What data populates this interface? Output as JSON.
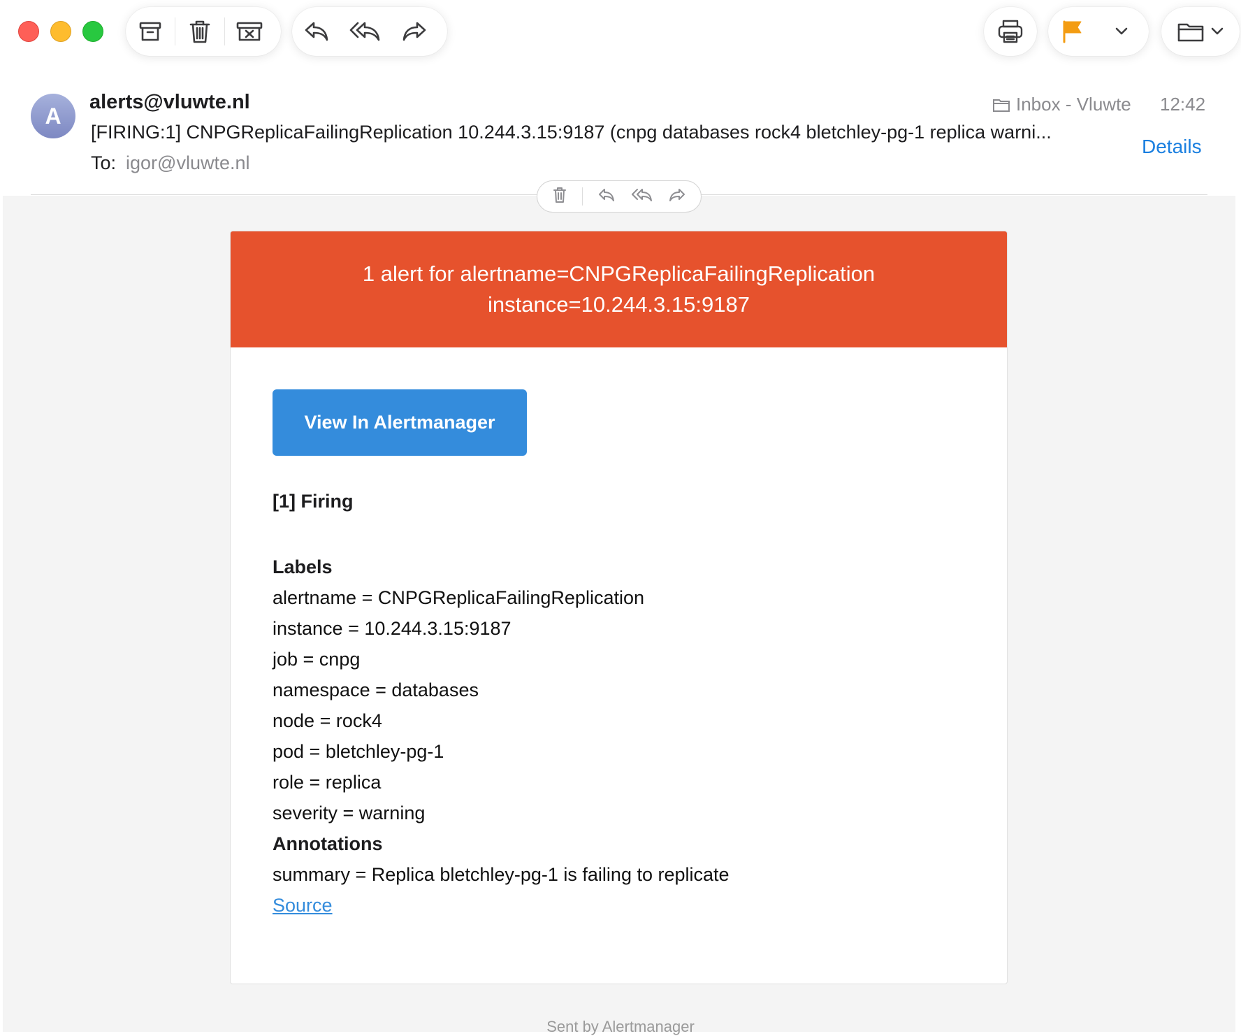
{
  "toolbar": {
    "archive_icon": "archive-box-icon",
    "trash_icon": "trash-icon",
    "junk_icon": "junk-box-icon",
    "reply_icon": "reply-icon",
    "reply_all_icon": "reply-all-icon",
    "forward_icon": "forward-icon",
    "print_icon": "printer-icon",
    "flag_color": "#f39c12",
    "move_icon": "folder-icon"
  },
  "message": {
    "avatar_letter": "A",
    "from": "alerts@vluwte.nl",
    "subject": "[FIRING:1] CNPGReplicaFailingReplication 10.244.3.15:9187 (cnpg databases rock4 bletchley-pg-1 replica warni...",
    "to_label": "To:",
    "to_address": "igor@vluwte.nl",
    "mailbox": "Inbox - Vluwte",
    "time": "12:42",
    "details_label": "Details"
  },
  "email": {
    "header_line1": "1 alert for alertname=CNPGReplicaFailingReplication",
    "header_line2": "instance=10.244.3.15:9187",
    "button_label": "View In Alertmanager",
    "firing": "[1] Firing",
    "labels_title": "Labels",
    "labels": [
      "alertname = CNPGReplicaFailingReplication",
      "instance = 10.244.3.15:9187",
      "job = cnpg",
      "namespace = databases",
      "node = rock4",
      "pod = bletchley-pg-1",
      "role = replica",
      "severity = warning"
    ],
    "annotations_title": "Annotations",
    "annotations": [
      "summary = Replica bletchley-pg-1 is failing to replicate"
    ],
    "source_label": "Source",
    "footer": "Sent by Alertmanager"
  },
  "colors": {
    "header_bg": "#e6522d",
    "button_bg": "#348cdc",
    "link": "#1a7fe0"
  }
}
